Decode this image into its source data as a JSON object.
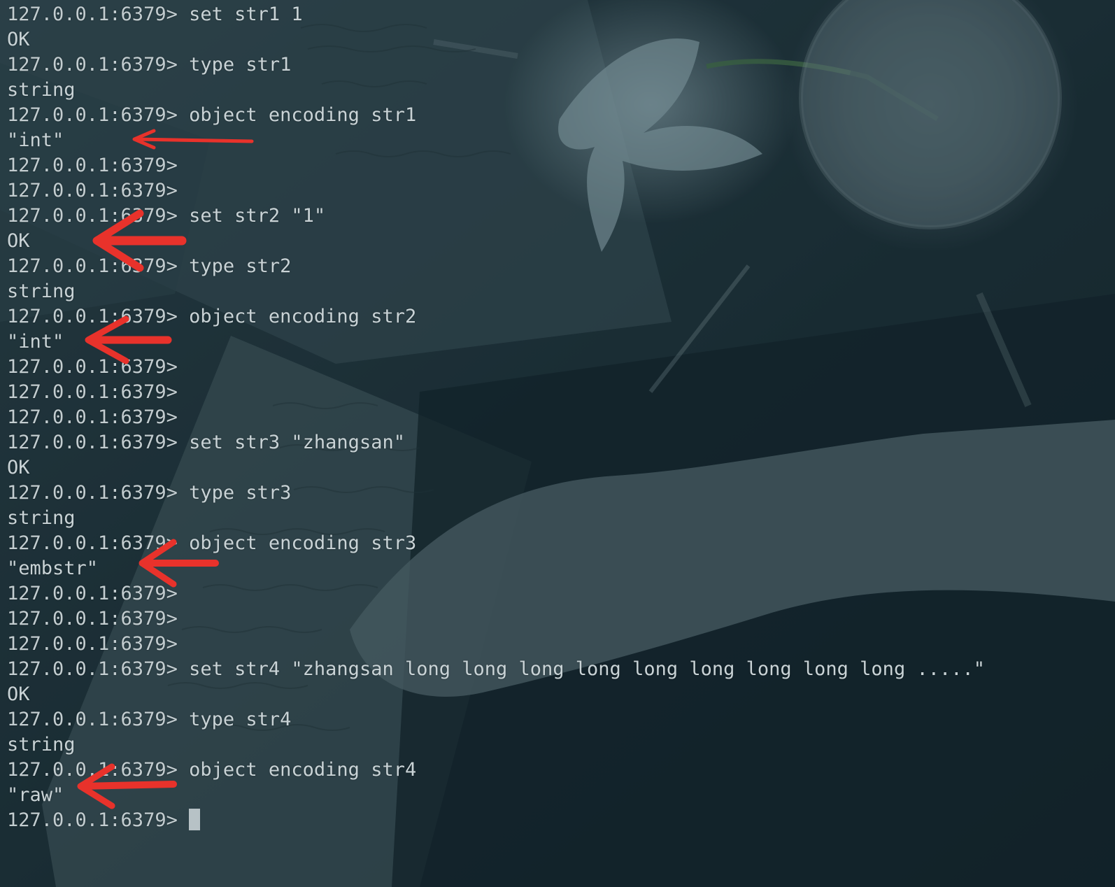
{
  "colors": {
    "background": "#1e3038",
    "text": "#c9d3d6",
    "annotation_arrow": "#e8322b",
    "cursor": "#b7c2c6"
  },
  "terminal": {
    "lines": [
      {
        "prompt": "127.0.0.1:6379>",
        "text": "set str1 1"
      },
      {
        "text": "OK"
      },
      {
        "prompt": "127.0.0.1:6379>",
        "text": "type str1"
      },
      {
        "text": "string"
      },
      {
        "prompt": "127.0.0.1:6379>",
        "text": "object encoding str1"
      },
      {
        "text": "\"int\""
      },
      {
        "prompt": "127.0.0.1:6379>",
        "text": ""
      },
      {
        "prompt": "127.0.0.1:6379>",
        "text": ""
      },
      {
        "prompt": "127.0.0.1:6379>",
        "text": "set str2 \"1\""
      },
      {
        "text": "OK"
      },
      {
        "prompt": "127.0.0.1:6379>",
        "text": "type str2"
      },
      {
        "text": "string"
      },
      {
        "prompt": "127.0.0.1:6379>",
        "text": "object encoding str2"
      },
      {
        "text": "\"int\""
      },
      {
        "prompt": "127.0.0.1:6379>",
        "text": ""
      },
      {
        "prompt": "127.0.0.1:6379>",
        "text": ""
      },
      {
        "prompt": "127.0.0.1:6379>",
        "text": ""
      },
      {
        "prompt": "127.0.0.1:6379>",
        "text": "set str3 \"zhangsan\""
      },
      {
        "text": "OK"
      },
      {
        "prompt": "127.0.0.1:6379>",
        "text": "type str3"
      },
      {
        "text": "string"
      },
      {
        "prompt": "127.0.0.1:6379>",
        "text": "object encoding str3"
      },
      {
        "text": "\"embstr\""
      },
      {
        "prompt": "127.0.0.1:6379>",
        "text": ""
      },
      {
        "prompt": "127.0.0.1:6379>",
        "text": ""
      },
      {
        "prompt": "127.0.0.1:6379>",
        "text": ""
      },
      {
        "prompt": "127.0.0.1:6379>",
        "text": "set str4 \"zhangsan long long long long long long long long long .....\""
      },
      {
        "text": "OK"
      },
      {
        "prompt": "127.0.0.1:6379>",
        "text": "type str4"
      },
      {
        "text": "string"
      },
      {
        "prompt": "127.0.0.1:6379>",
        "text": "object encoding str4"
      },
      {
        "text": "\"raw\""
      },
      {
        "prompt": "127.0.0.1:6379>",
        "text": "",
        "cursor": true
      }
    ]
  }
}
